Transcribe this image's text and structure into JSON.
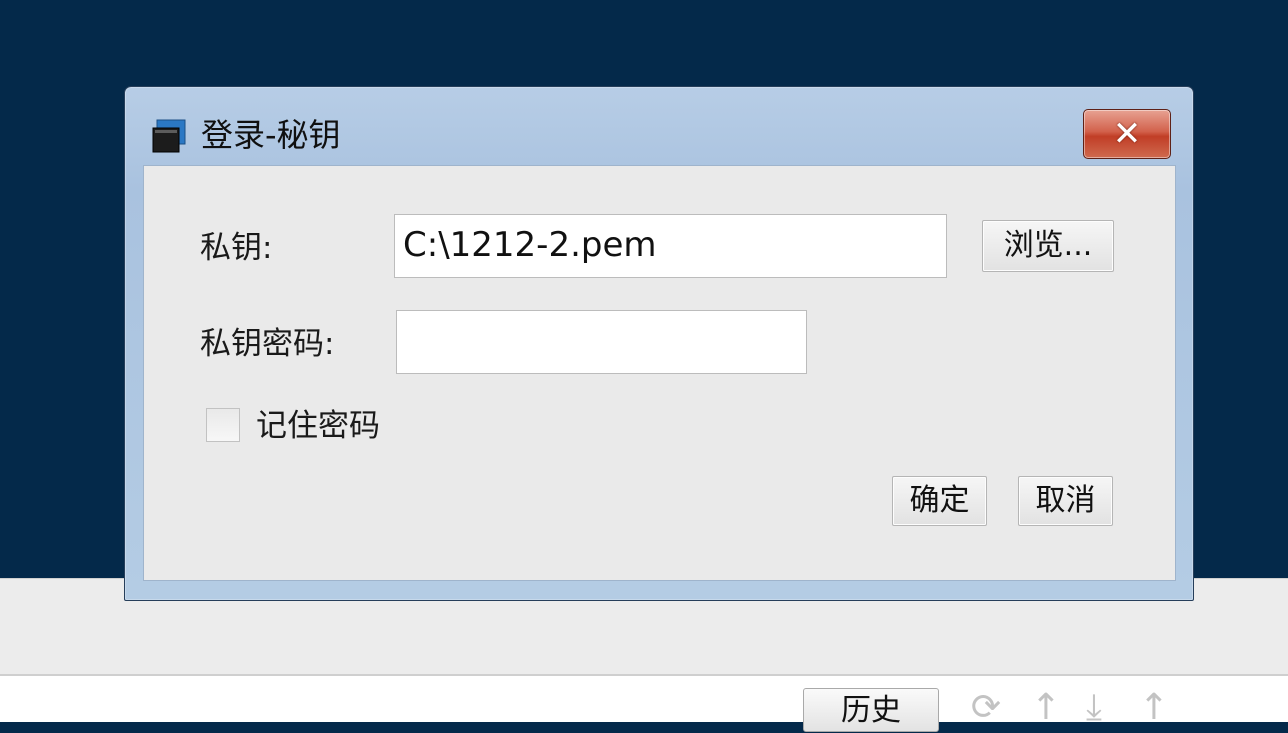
{
  "dialog": {
    "title": "登录-秘钥",
    "close_glyph": "✕",
    "private_key_label": "私钥:",
    "private_key_value": "C:\\1212-2.pem",
    "browse_label": "浏览...",
    "passphrase_label": "私钥密码:",
    "passphrase_value": "",
    "remember_label": "记住密码",
    "ok_label": "确定",
    "cancel_label": "取消"
  },
  "background": {
    "history_label": "历史",
    "toolbar_icons": [
      "refresh-icon",
      "upload-icon",
      "download-icon",
      "upload-icon"
    ]
  },
  "colors": {
    "desktop": "#04294a",
    "close_button": "#c13e26",
    "dialog_frame": "#b4cce4"
  }
}
